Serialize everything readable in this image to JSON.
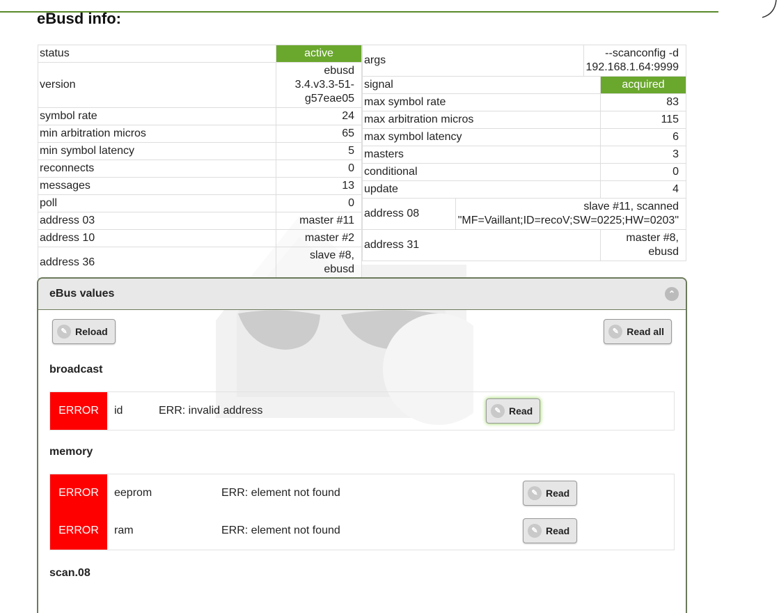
{
  "title": "eBusd info:",
  "left_table": [
    {
      "label": "status",
      "value": "active",
      "highlight": true
    },
    {
      "label": "version",
      "value": "ebusd 3.4.v3.3-51-g57eae05"
    },
    {
      "label": "symbol rate",
      "value": "24"
    },
    {
      "label": "min arbitration micros",
      "value": "65"
    },
    {
      "label": "min symbol latency",
      "value": "5"
    },
    {
      "label": "reconnects",
      "value": "0"
    },
    {
      "label": "messages",
      "value": "13"
    },
    {
      "label": "poll",
      "value": "0"
    },
    {
      "label": "address 03",
      "value": "master #11"
    },
    {
      "label": "address 10",
      "value": "master #2"
    },
    {
      "label": "address 36",
      "value": "slave #8, ebusd"
    }
  ],
  "right_table": [
    {
      "label": "args",
      "value": "--scanconfig -d 192.168.1.64:9999"
    },
    {
      "label": "signal",
      "value": "acquired",
      "highlight": true
    },
    {
      "label": "max symbol rate",
      "value": "83"
    },
    {
      "label": "max arbitration micros",
      "value": "115"
    },
    {
      "label": "max symbol latency",
      "value": "6"
    },
    {
      "label": "masters",
      "value": "3"
    },
    {
      "label": "conditional",
      "value": "0"
    },
    {
      "label": "update",
      "value": "4"
    },
    {
      "label": "address 08",
      "value": "slave #11, scanned \"MF=Vaillant;ID=recoV;SW=0225;HW=0203\""
    },
    {
      "label": "address 31",
      "value": "master #8, ebusd"
    }
  ],
  "panel": {
    "title": "eBus values",
    "reload": "Reload",
    "read_all": "Read all"
  },
  "sections": [
    {
      "name": "broadcast",
      "rows": [
        {
          "status": "ERROR",
          "name": "id",
          "message": "ERR: invalid address",
          "button": "Read"
        }
      ]
    },
    {
      "name": "memory",
      "rows": [
        {
          "status": "ERROR",
          "name": "eeprom",
          "message": "ERR: element not found",
          "button": "Read"
        },
        {
          "status": "ERROR",
          "name": "ram",
          "message": "ERR: element not found",
          "button": "Read"
        }
      ]
    },
    {
      "name": "scan.08",
      "rows": []
    }
  ],
  "colors": {
    "accent": "#6aa72d",
    "error": "#ff0000"
  }
}
